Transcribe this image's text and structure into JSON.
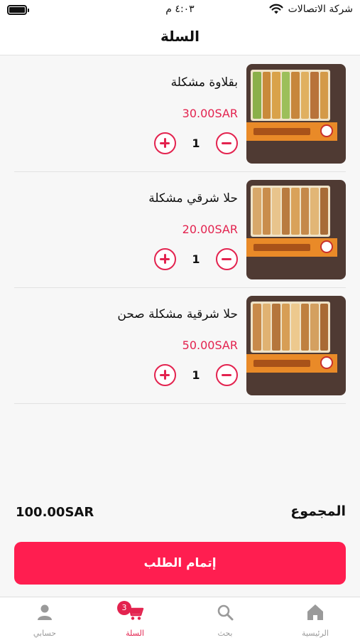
{
  "status_bar": {
    "carrier": "شركة الاتصالات",
    "time": "٤:٠٣ م"
  },
  "header": {
    "title": "السلة"
  },
  "cart": {
    "items": [
      {
        "name": "بقلاوة مشكلة",
        "price": "30.00SAR",
        "quantity": "1",
        "image": "assorted-baklava-tray"
      },
      {
        "name": "حلا شرقي مشكلة",
        "price": "20.00SAR",
        "quantity": "1",
        "image": "assorted-eastern-sweets-tray"
      },
      {
        "name": "حلا شرقية مشكلة صحن",
        "price": "50.00SAR",
        "quantity": "1",
        "image": "assorted-eastern-sweets-plate"
      }
    ]
  },
  "summary": {
    "total_label": "المجموع",
    "total_value": "100.00SAR"
  },
  "checkout": {
    "label": "إتمام الطلب"
  },
  "tab_bar": {
    "tabs": [
      {
        "label": "حسابي",
        "icon": "person-icon"
      },
      {
        "label": "السلة",
        "icon": "cart-icon",
        "badge": "3",
        "active": true
      },
      {
        "label": "بحث",
        "icon": "search-icon"
      },
      {
        "label": "الرئيسية",
        "icon": "home-icon"
      }
    ]
  },
  "colors": {
    "accent": "#e3234f",
    "checkout_button": "#ff1e50",
    "tab_inactive": "#9a9a9a"
  }
}
